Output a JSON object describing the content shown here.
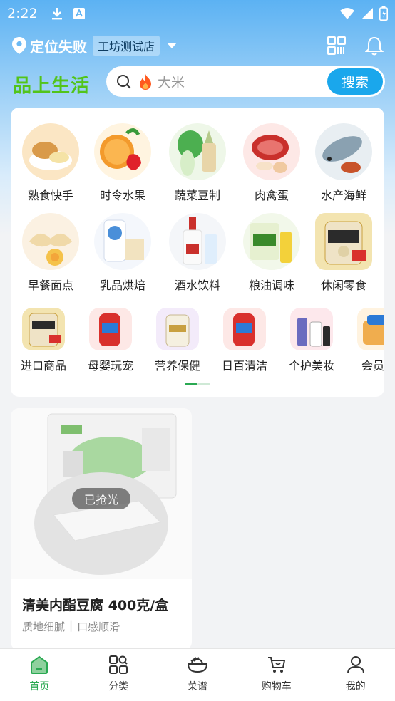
{
  "status_bar": {
    "time": "2:22"
  },
  "header": {
    "location_text": "定位失败",
    "store_name": "工坊测试店"
  },
  "brand": {
    "name": "品上生活"
  },
  "search": {
    "placeholder": "大米",
    "button_label": "搜索"
  },
  "categories": [
    {
      "label": "熟食快手",
      "color": "#f3c77a"
    },
    {
      "label": "时令水果",
      "color": "#f39a2c"
    },
    {
      "label": "蔬菜豆制",
      "color": "#5cb85c"
    },
    {
      "label": "肉禽蛋",
      "color": "#d9534f"
    },
    {
      "label": "水产海鲜",
      "color": "#8aa1b1"
    },
    {
      "label": "早餐面点",
      "color": "#f0d9a8"
    },
    {
      "label": "乳品烘焙",
      "color": "#4a8fd9"
    },
    {
      "label": "酒水饮料",
      "color": "#c9302c"
    },
    {
      "label": "粮油调味",
      "color": "#7fbf3f"
    },
    {
      "label": "休闲零食",
      "color": "#e8c25a"
    },
    {
      "label": "进口商品",
      "color": "#e8c25a"
    },
    {
      "label": "母婴玩宠",
      "color": "#d9534f"
    },
    {
      "label": "营养保健",
      "color": "#d8c9a8"
    },
    {
      "label": "日百清洁",
      "color": "#d9534f"
    },
    {
      "label": "个护美妆",
      "color": "#6b6bbf"
    },
    {
      "label": "会员专",
      "color": "#f0ad4e"
    }
  ],
  "product": {
    "name": "清美内酯豆腐 400克/盒",
    "tags": [
      "质地细腻",
      "口感顺滑"
    ],
    "status_badge": "已抢光"
  },
  "bottom_nav": [
    {
      "label": "首页",
      "icon": "home-icon",
      "active": true
    },
    {
      "label": "分类",
      "icon": "category-icon",
      "active": false
    },
    {
      "label": "菜谱",
      "icon": "recipe-icon",
      "active": false
    },
    {
      "label": "购物车",
      "icon": "cart-icon",
      "active": false
    },
    {
      "label": "我的",
      "icon": "profile-icon",
      "active": false
    }
  ],
  "colors": {
    "accent": "#2aa952",
    "brand_green": "#52c41a",
    "search_blue": "#1aa7ec"
  }
}
